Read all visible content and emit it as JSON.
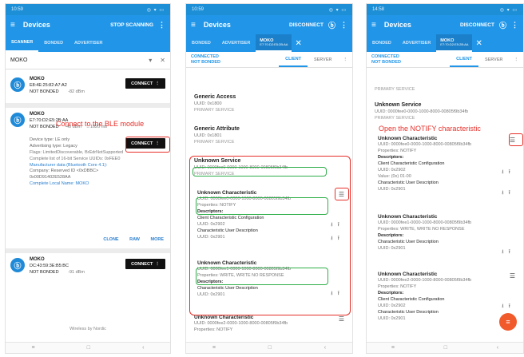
{
  "phone1": {
    "status": {
      "time": "10:59",
      "icons": "◎ ▾ ▭"
    },
    "appbar": {
      "title": "Devices",
      "action": "STOP SCANNING"
    },
    "tabs": [
      "SCANNER",
      "BONDED",
      "ADVERTISER"
    ],
    "filter": {
      "text": "MOKO",
      "dropdown": "▾",
      "clear": "✕"
    },
    "devices": [
      {
        "name": "MOKO",
        "mac": "E8:4E:25:82:A7:A2",
        "bond": "NOT BONDED",
        "rssi": "-82 dBm",
        "connect": "CONNECT"
      },
      {
        "name": "MOKO",
        "mac": "E7:70:D2:E5:2B:AA",
        "bond": "NOT BONDED",
        "rssi": "-40 dBm",
        "interval": "↔1020 ms",
        "connect": "CONNECT",
        "details": [
          "Device type: LE only",
          "Advertising type: Legacy",
          "Flags: LimitedDiscoverable, BrEdrNotSupported",
          "Complete list of 16-bit Service UUIDs: 0xFEE0",
          "Manufacturer data (Bluetooth Core 4.1):",
          "Company: Reserved ID <0xDBBC>",
          "0x00D91402E528AA"
        ],
        "local_name": "Complete Local Name: MOKO",
        "actions": [
          "CLONE",
          "RAW",
          "MORE"
        ]
      },
      {
        "name": "MOKO",
        "mac": "DC:43:59:3E:B5:BC",
        "bond": "NOT BONDED",
        "rssi": "-91 dBm",
        "connect": "CONNECT"
      }
    ],
    "footer": "Wireless by Nordic",
    "annotation": "Connect to the BLE module"
  },
  "phone2": {
    "status": {
      "time": "10:59",
      "icons": "◎ ▾ ▭"
    },
    "appbar": {
      "title": "Devices",
      "action": "DISCONNECT"
    },
    "tabs": [
      "BONDED",
      "ADVERTISER"
    ],
    "device_tab": {
      "name": "MOKO",
      "mac": "E7:70:D2:E5:2B:AA"
    },
    "conn": {
      "line1": "CONNECTED",
      "line2": "NOT BONDED",
      "client": "CLIENT",
      "server": "SERVER"
    },
    "services": [
      {
        "title": "Generic Access",
        "uuid": "UUID: 0x1800",
        "type": "PRIMARY SERVICE"
      },
      {
        "title": "Generic Attribute",
        "uuid": "UUID: 0x1801",
        "type": "PRIMARY SERVICE"
      },
      {
        "title": "Unknown Service",
        "uuid": "UUID: 0000fee0-0000-1000-8000-00805f9b34fb",
        "type": "PRIMARY SERVICE"
      }
    ],
    "char1": {
      "title": "Unknown Characteristic",
      "uuid": "UUID: 0000fee0-0000-1000-8000-00805f9b34fb",
      "props": "Properties: NOTIFY",
      "descriptors": "Descriptors:",
      "d1": "Client Characteristic Configuration",
      "d1u": "UUID: 0x2902",
      "d2": "Characteristic User Description",
      "d2u": "UUID: 0x2901"
    },
    "char2": {
      "title": "Unknown Characteristic",
      "uuid": "UUID: 0000fee1-0000-1000-8000-00805f9b34fb",
      "props": "Properties: WRITE, WRITE NO RESPONSE",
      "descriptors": "Descriptors:",
      "d1": "Characteristic User Description",
      "d1u": "UUID: 0x2901"
    },
    "char3": {
      "title": "Unknown Characteristic",
      "uuid": "UUID: 0000fee2-0000-1000-8000-00805f9b34fb",
      "props": "Properties: NOTIFY"
    }
  },
  "phone3": {
    "status": {
      "time": "14:58",
      "icons": "◎ ▾ ▭"
    },
    "appbar": {
      "title": "Devices",
      "action": "DISCONNECT"
    },
    "tabs": [
      "BONDED",
      "ADVERTISER"
    ],
    "device_tab": {
      "name": "MOKO",
      "mac": "E7:70:D2:E5:2B:AA"
    },
    "conn": {
      "line1": "CONNECTED",
      "line2": "NOT BONDED",
      "client": "CLIENT",
      "server": "SERVER"
    },
    "top_cut": "PRIMARY SERVICE",
    "service": {
      "title": "Unknown Service",
      "uuid": "UUID: 0000fee0-0000-1000-8000-00805f9b34fb",
      "type": "PRIMARY SERVICE"
    },
    "annotation": "Open the NOTIFY characteristic",
    "char1": {
      "title": "Unknown Characteristic",
      "uuid": "UUID: 0000fee0-0000-1000-8000-00805f9b34fb",
      "props": "Properties: NOTIFY",
      "descriptors": "Descriptors:",
      "d1": "Client Characteristic Configuration",
      "d1u": "UUID: 0x2902",
      "d1v": "Value: (0x) 01-00",
      "d2": "Characteristic User Description",
      "d2u": "UUID: 0x2901"
    },
    "char2": {
      "title": "Unknown Characteristic",
      "uuid": "UUID: 0000fee1-0000-1000-8000-00805f9b34fb",
      "props": "Properties: WRITE, WRITE NO RESPONSE",
      "descriptors": "Descriptors:",
      "d1": "Characteristic User Description",
      "d1u": "UUID: 0x2901"
    },
    "char3": {
      "title": "Unknown Characteristic",
      "uuid": "UUID: 0000fee2-0000-1000-8000-00805f9b34fb",
      "props": "Properties: NOTIFY",
      "descriptors": "Descriptors:",
      "d1": "Client Characteristic Configuration",
      "d1u": "UUID: 0x2902",
      "d2": "Characteristic User Description",
      "d2u": "UUID: 0x2901"
    }
  },
  "icons": {
    "menu": "≡",
    "more": "⋮",
    "bluetooth": "ⓑ",
    "download": "⭳",
    "upload": "⭱",
    "list": "☰",
    "fab": "≡",
    "back": "‹",
    "home": "○",
    "recent": "□"
  },
  "colors": {
    "primary": "#2196e8",
    "annotation_red": "#e5302a",
    "highlight_green": "#2fae4a",
    "fab_orange": "#f15a2b"
  }
}
